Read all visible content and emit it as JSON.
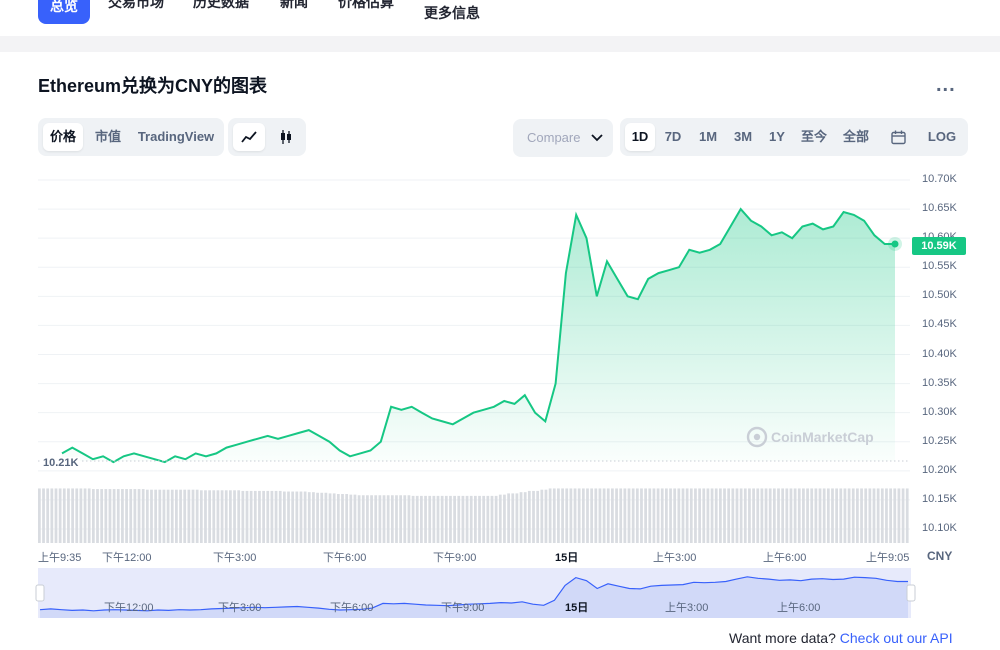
{
  "nav": {
    "tabs": [
      "总览",
      "交易市场",
      "历史数据",
      "新闻",
      "价格估算",
      "更多信息"
    ]
  },
  "chart_header": {
    "title": "Ethereum兑换为CNY的图表",
    "more_label": "..."
  },
  "view_tabs": [
    "价格",
    "市值",
    "TradingView"
  ],
  "icons": {
    "line": "line-chart-icon",
    "candle": "candlestick-icon",
    "calendar": "calendar-icon",
    "chevron": "chevron-down-icon",
    "logo": "coinmarketcap-logo-icon"
  },
  "compare_label": "Compare",
  "range_tabs": [
    "1D",
    "7D",
    "1M",
    "3M",
    "1Y",
    "至今",
    "全部"
  ],
  "log_label": "LOG",
  "colors": {
    "accent": "#3861fb",
    "up": "#16c784",
    "text": "#58667e"
  },
  "watermark": "CoinMarketCap",
  "footer": {
    "text": "Want more data?",
    "link": "Check out our API"
  },
  "chart_data": {
    "type": "area",
    "currency": "CNY",
    "y_axis_labels": [
      "10.70K",
      "10.65K",
      "10.60K",
      "10.55K",
      "10.50K",
      "10.45K",
      "10.40K",
      "10.35K",
      "10.30K",
      "10.25K",
      "10.20K",
      "10.15K",
      "10.10K"
    ],
    "ylim": [
      10.075,
      10.72
    ],
    "x_axis_labels": [
      "上午9:35",
      "下午12:00",
      "下午3:00",
      "下午6:00",
      "下午9:00",
      "15日",
      "上午3:00",
      "上午6:00",
      "上午9:05"
    ],
    "navigator_labels": [
      "下午12:00",
      "下午3:00",
      "下午6:00",
      "下午9:00",
      "15日",
      "上午3:00",
      "上午6:00"
    ],
    "start_price_label": "10.21K",
    "current_price_label": "10.59K",
    "series": [
      {
        "values": [
          10.23,
          10.24,
          10.23,
          10.22,
          10.225,
          10.215,
          10.225,
          10.23,
          10.225,
          10.22,
          10.215,
          10.225,
          10.22,
          10.23,
          10.225,
          10.23,
          10.24,
          10.245,
          10.25,
          10.255,
          10.26,
          10.255,
          10.26,
          10.265,
          10.27,
          10.26,
          10.25,
          10.235,
          10.225,
          10.23,
          10.235,
          10.25,
          10.31,
          10.305,
          10.31,
          10.3,
          10.29,
          10.285,
          10.28,
          10.29,
          10.3,
          10.305,
          10.31,
          10.32,
          10.315,
          10.33,
          10.3,
          10.285,
          10.35,
          10.54,
          10.64,
          10.6,
          10.5,
          10.56,
          10.53,
          10.5,
          10.495,
          10.53,
          10.54,
          10.545,
          10.55,
          10.58,
          10.575,
          10.58,
          10.59,
          10.62,
          10.65,
          10.63,
          10.62,
          10.605,
          10.61,
          10.6,
          10.62,
          10.625,
          10.615,
          10.62,
          10.645,
          10.64,
          10.63,
          10.605,
          10.59,
          10.59
        ]
      }
    ],
    "volume": [
      0.88,
      0.88,
      0.88,
      0.88,
      0.88,
      0.87,
      0.87,
      0.87,
      0.87,
      0.87,
      0.86,
      0.86,
      0.86,
      0.86,
      0.86,
      0.85,
      0.85,
      0.85,
      0.85,
      0.84,
      0.84,
      0.84,
      0.84,
      0.83,
      0.83,
      0.82,
      0.81,
      0.8,
      0.79,
      0.78,
      0.77,
      0.77,
      0.77,
      0.77,
      0.77,
      0.76,
      0.76,
      0.76,
      0.76,
      0.76,
      0.76,
      0.76,
      0.76,
      0.78,
      0.8,
      0.82,
      0.84,
      0.86,
      0.88,
      0.88,
      0.88,
      0.88,
      0.88,
      0.88,
      0.88,
      0.88,
      0.88,
      0.88,
      0.88,
      0.88,
      0.88,
      0.88,
      0.88,
      0.88,
      0.88,
      0.88,
      0.88,
      0.88,
      0.88,
      0.88,
      0.88,
      0.88,
      0.88,
      0.88,
      0.88,
      0.88,
      0.88,
      0.88,
      0.88,
      0.88,
      0.88,
      0.88
    ]
  }
}
